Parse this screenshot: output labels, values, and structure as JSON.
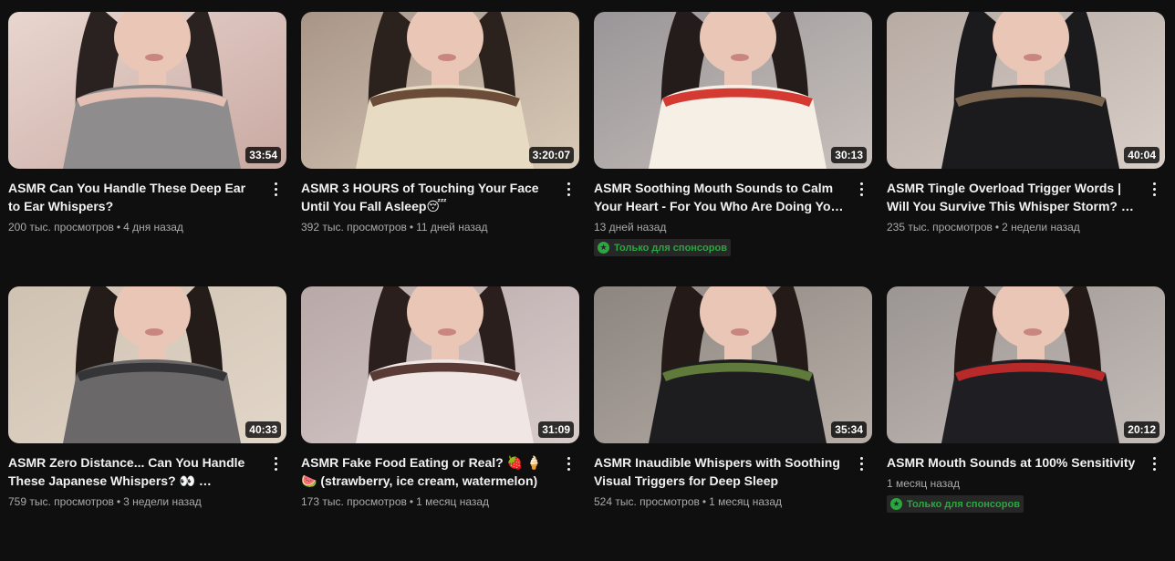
{
  "videos": [
    {
      "title": "ASMR Can You Handle These Deep Ear to Ear Whispers?",
      "duration": "33:54",
      "views": "200 тыс. просмотров",
      "age": "4 дня назад",
      "sponsor_label": "",
      "palette": [
        "#e8d6cf",
        "#c9a9a2",
        "#8f8c8e",
        "#2a2220",
        "#e4bfb3"
      ]
    },
    {
      "title": "ASMR 3 HOURS of Touching Your Face Until You Fall Asleep😴",
      "duration": "3:20:07",
      "views": "392 тыс. просмотров",
      "age": "11 дней назад",
      "sponsor_label": "",
      "palette": [
        "#a89588",
        "#d9cbb8",
        "#e7dcc3",
        "#2c221d",
        "#6b4c39"
      ]
    },
    {
      "title": "ASMR Soothing Mouth Sounds to Calm Your Heart - For You Who Are Doing Your Best…",
      "duration": "30:13",
      "views": "",
      "age": "13 дней назад",
      "sponsor_label": "Только для спонсоров",
      "palette": [
        "#9a9598",
        "#c7c0bb",
        "#f6efe5",
        "#241c1a",
        "#d53a32"
      ]
    },
    {
      "title": "ASMR Tingle Overload Trigger Words | Will You Survive This Whisper Storm? 👂 🌀",
      "duration": "40:04",
      "views": "235 тыс. просмотров",
      "age": "2 недели назад",
      "sponsor_label": "",
      "palette": [
        "#b7aba4",
        "#d8cec7",
        "#1b1a1c",
        "#1b1a1c",
        "#7a6550"
      ]
    },
    {
      "title": "ASMR Zero Distance... Can You Handle These Japanese Whispers? 👀 …",
      "duration": "40:33",
      "views": "759 тыс. просмотров",
      "age": "3 недели назад",
      "sponsor_label": "",
      "palette": [
        "#cfc2b3",
        "#e2d6c8",
        "#6a6868",
        "#231c19",
        "#353538"
      ]
    },
    {
      "title": "ASMR Fake Food Eating or Real? 🍓 🍦 🍉 (strawberry, ice cream, watermelon)",
      "duration": "31:09",
      "views": "173 тыс. просмотров",
      "age": "1 месяц назад",
      "sponsor_label": "",
      "palette": [
        "#b8a8a8",
        "#d8cccb",
        "#f0e7e4",
        "#2a1f1c",
        "#5a3a34"
      ]
    },
    {
      "title": "ASMR Inaudible Whispers with Soothing Visual Triggers for Deep Sleep",
      "duration": "35:34",
      "views": "524 тыс. просмотров",
      "age": "1 месяц назад",
      "sponsor_label": "",
      "palette": [
        "#8c8580",
        "#b7aea6",
        "#1d1c1e",
        "#241b18",
        "#5f7a3b"
      ]
    },
    {
      "title": "ASMR Mouth Sounds at 100% Sensitivity",
      "duration": "20:12",
      "views": "",
      "age": "1 месяц назад",
      "sponsor_label": "Только для спонсоров",
      "palette": [
        "#9b9593",
        "#c4bcb7",
        "#1f1e22",
        "#231a17",
        "#b82a2a"
      ]
    }
  ]
}
